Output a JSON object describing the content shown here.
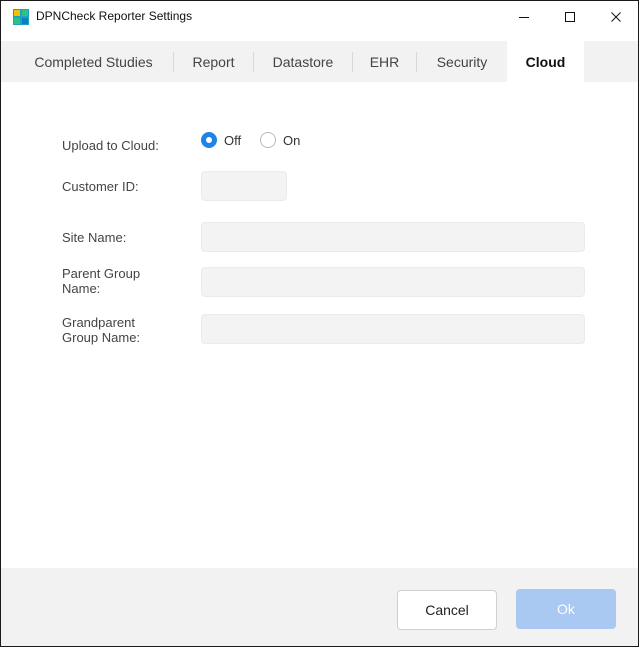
{
  "window": {
    "title": "DPNCheck Reporter Settings",
    "icon": "app-logo-icon"
  },
  "tabs": [
    {
      "label": "Completed Studies",
      "active": false
    },
    {
      "label": "Report",
      "active": false
    },
    {
      "label": "Datastore",
      "active": false
    },
    {
      "label": "EHR",
      "active": false
    },
    {
      "label": "Security",
      "active": false
    },
    {
      "label": "Cloud",
      "active": true
    }
  ],
  "form": {
    "upload_label": "Upload to Cloud:",
    "upload_options": [
      {
        "label": "Off",
        "selected": true
      },
      {
        "label": "On",
        "selected": false
      }
    ],
    "customer_id_label": "Customer ID:",
    "customer_id_value": "",
    "site_name_label": "Site Name:",
    "site_name_value": "",
    "parent_group_label_line1": "Parent Group",
    "parent_group_label_line2": "Name:",
    "parent_group_value": "",
    "grandparent_group_label_line1": "Grandparent",
    "grandparent_group_label_line2": "Group Name:",
    "grandparent_group_value": ""
  },
  "footer": {
    "cancel_label": "Cancel",
    "ok_label": "Ok",
    "ok_enabled": false
  },
  "colors": {
    "accent": "#1f84e8",
    "ok_disabled": "#a9c8f2",
    "tab_bar": "#f2f2f2",
    "field_bg": "#f3f3f3"
  }
}
